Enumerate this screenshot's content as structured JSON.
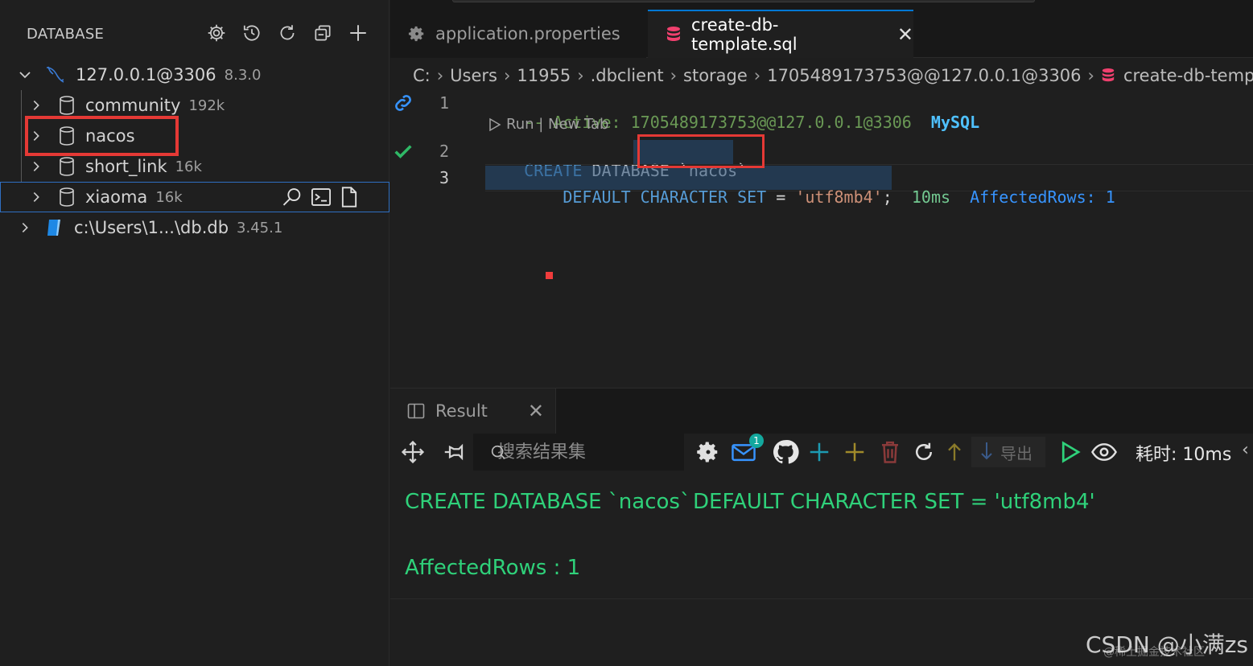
{
  "sidebar": {
    "title": "DATABASE",
    "actions": [
      "settings-icon",
      "history-icon",
      "refresh-icon",
      "collapse-all-icon",
      "add-icon"
    ],
    "connection": {
      "name": "127.0.0.1@3306",
      "version": "8.3.0"
    },
    "databases": [
      {
        "name": "community",
        "size": "192k"
      },
      {
        "name": "nacos",
        "size": ""
      },
      {
        "name": "short_link",
        "size": "16k"
      },
      {
        "name": "xiaoma",
        "size": "16k"
      }
    ],
    "sqlite": {
      "name": "c:\\Users\\1...\\db.db",
      "version": "3.45.1"
    }
  },
  "tabs": [
    {
      "label": "application.properties",
      "icon": "gear-icon"
    },
    {
      "label": "create-db-template.sql",
      "icon": "database-icon",
      "active": true
    }
  ],
  "breadcrumb": [
    "C:",
    "Users",
    "11955",
    ".dbclient",
    "storage",
    "1705489173753@@127.0.0.1@3306",
    "create-db-template"
  ],
  "editor": {
    "line_numbers": [
      "1",
      "2",
      "3"
    ],
    "line1_comment": "-- Active: 1705489173753@@127.0.0.1@3306",
    "line1_dbtype": "MySQL",
    "codelens": "Run | New Tab",
    "line2_kw1": "CREATE",
    "line2_kw2": "DATABAS",
    "line2_ident": "`nacos`",
    "line3_indent": "    ",
    "line3_kw": "DEFAULT CHARACTER SET",
    "line3_eq": " = ",
    "line3_str": "'utf8mb4'",
    "line3_semi": ";",
    "inlay_time": "10ms",
    "inlay_rows": "AffectedRows: 1"
  },
  "result": {
    "tab_label": "Result",
    "search_placeholder": "搜索结果集",
    "badge_count": "1",
    "export_label": "导出",
    "elapsed": "耗时: 10ms",
    "sql_part1": "CREATE DATABASE `nacos`",
    "sql_part2": "DEFAULT CHARACTER SET = 'utf8mb4'",
    "affected": "AffectedRows : 1"
  },
  "watermark": "CSDN @小满zs",
  "watermark_small": "@稀土掘金技术社区",
  "colors": {
    "accent": "#0078d4",
    "highlight": "#e53935",
    "success": "#2fd17a"
  }
}
